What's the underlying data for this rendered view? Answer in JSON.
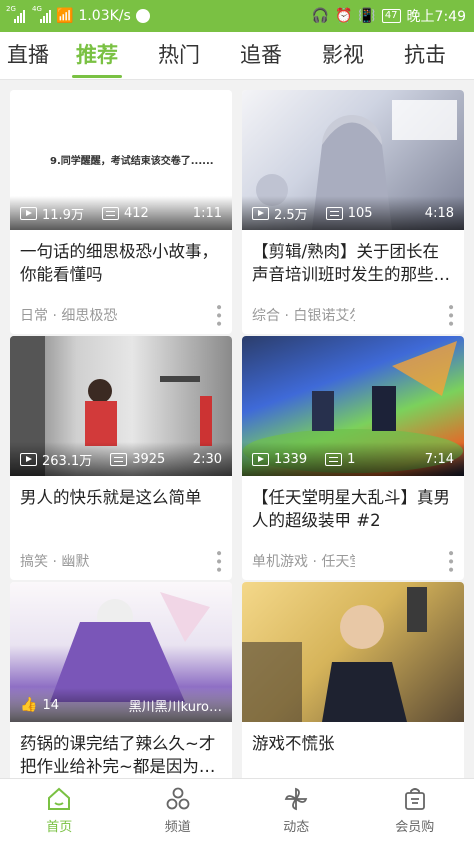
{
  "status_bar": {
    "net_labels": [
      "2G",
      "4G"
    ],
    "speed": "1.03K/s",
    "battery": "47",
    "time": "晚上7:49"
  },
  "tabs": [
    "直播",
    "推荐",
    "热门",
    "追番",
    "影视",
    "抗击"
  ],
  "active_tab": "推荐",
  "cards": [
    {
      "thumb_text": "9.同学醒醒，考试结束该交卷了......",
      "views": "11.9万",
      "danmaku": "412",
      "duration": "1:11",
      "title": "一句话的细思极恐小故事，你能看懂吗",
      "meta": "日常 · 细思极恐"
    },
    {
      "thumb_text": "",
      "views": "2.5万",
      "danmaku": "105",
      "duration": "4:18",
      "title": "【剪辑/熟肉】关于团长在声音培训班时发生的那些…",
      "meta": "综合 · 白银诺艾尔"
    },
    {
      "thumb_text": "",
      "views": "263.1万",
      "danmaku": "3925",
      "duration": "2:30",
      "title": "男人的快乐就是这么简单",
      "meta": "搞笑 · 幽默"
    },
    {
      "thumb_text": "",
      "views": "1339",
      "danmaku": "1",
      "duration": "7:14",
      "title": "【任天堂明星大乱斗】真男人的超级装甲 #2",
      "meta": "单机游戏 · 任天堂明星…"
    },
    {
      "likes": "14",
      "author": "黑川黑川kuro…",
      "title": "药锅的课完结了辣么久~才把作业给补完~都是因为…"
    },
    {
      "title": "游戏不慌张"
    }
  ],
  "bottom_nav": [
    {
      "label": "首页",
      "icon": "home-icon"
    },
    {
      "label": "频道",
      "icon": "channel-icon"
    },
    {
      "label": "动态",
      "icon": "pinwheel-icon"
    },
    {
      "label": "会员购",
      "icon": "shopping-bag-icon"
    }
  ],
  "colors": {
    "accent": "#7ac143"
  }
}
